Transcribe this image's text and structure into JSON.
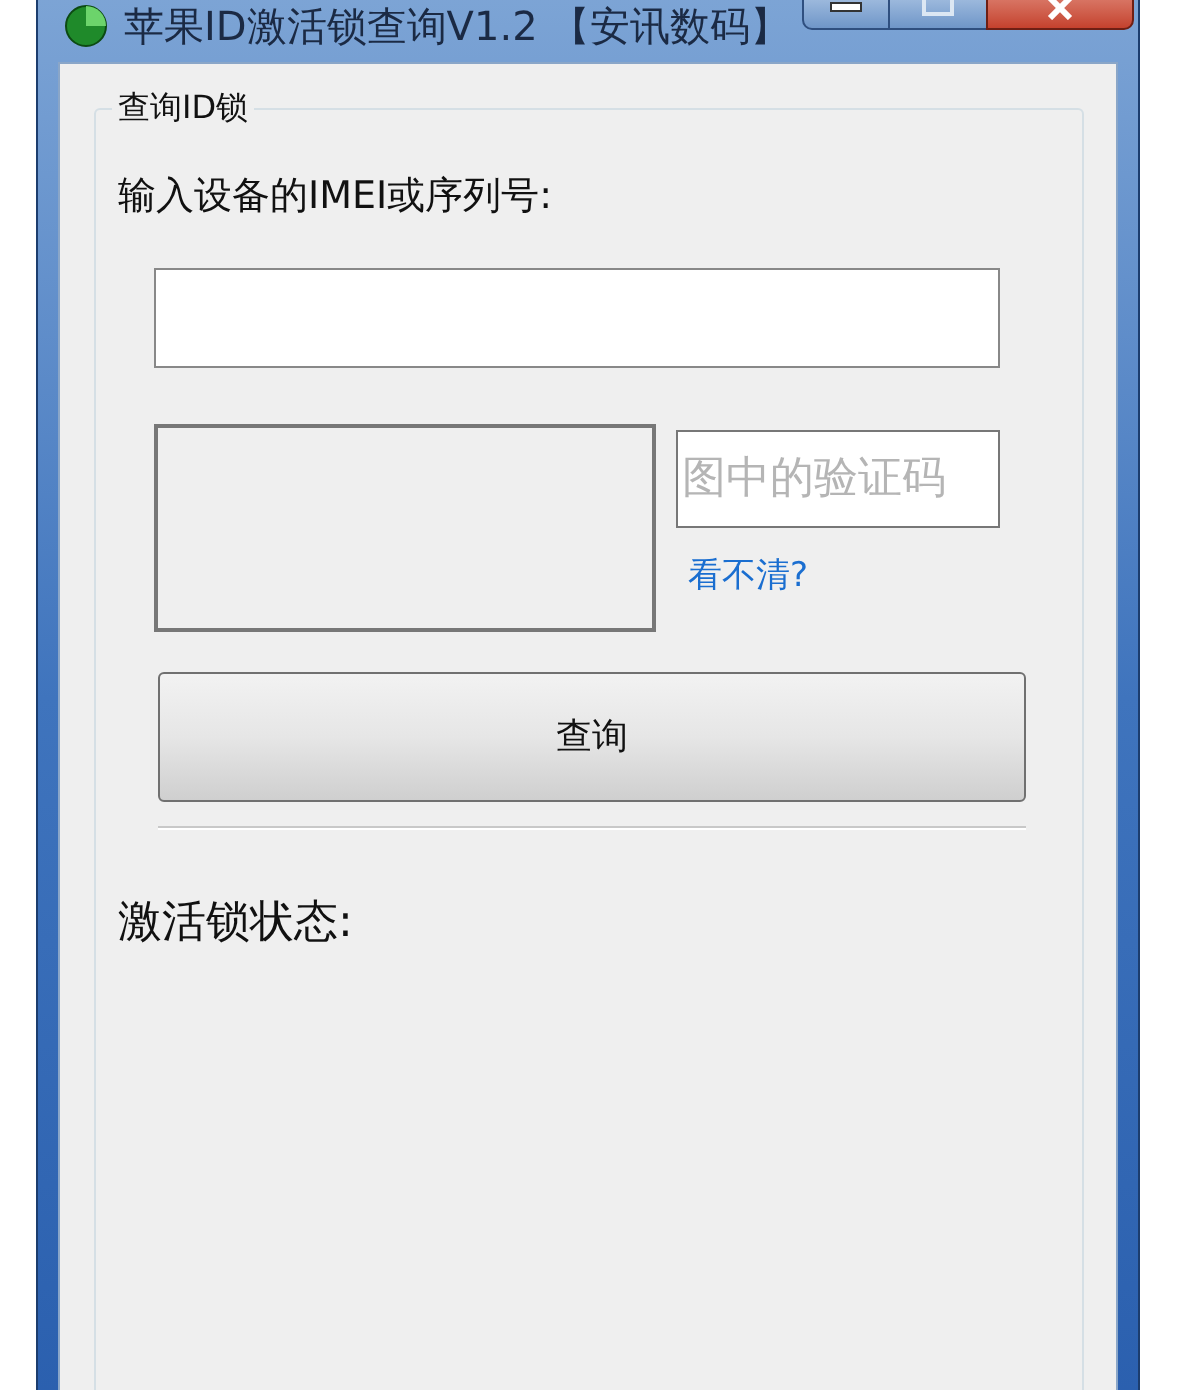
{
  "window": {
    "title": "苹果ID激活锁查询V1.2 【安讯数码】"
  },
  "group": {
    "title": "查询ID锁"
  },
  "imei": {
    "label": "输入设备的IMEI或序列号:"
  },
  "captcha": {
    "placeholder": "图中的验证码",
    "refresh_link": "看不清?"
  },
  "query_button": "查询",
  "status": {
    "label": "激活锁状态:"
  }
}
